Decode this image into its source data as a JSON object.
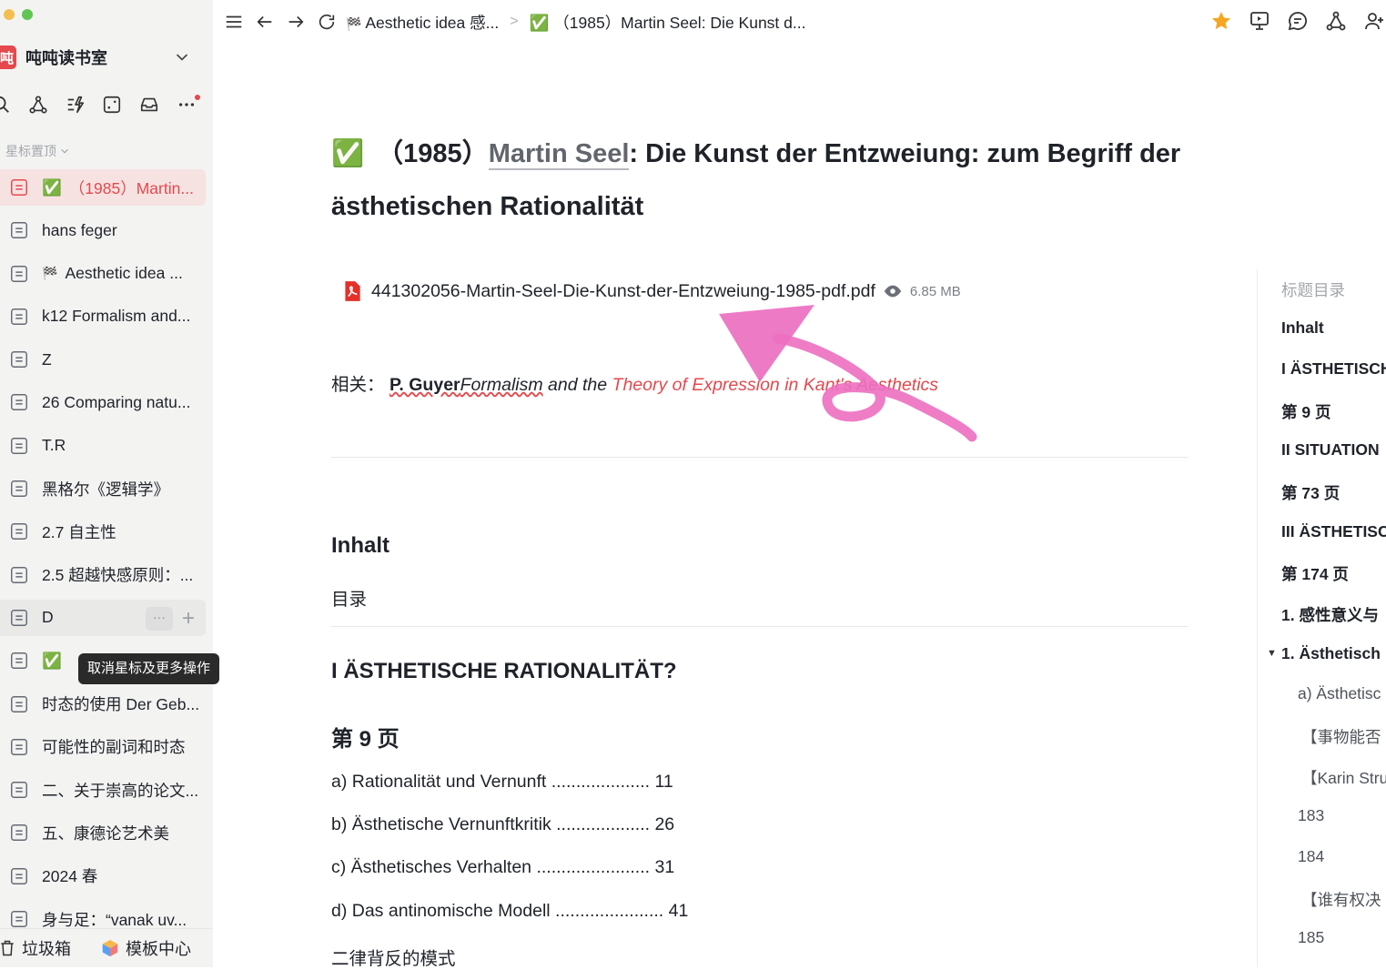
{
  "sidebar": {
    "workspace": {
      "logo": "吨",
      "name": "吨吨读书室"
    },
    "section_title": "星标置顶",
    "items": [
      {
        "emoji": "✅",
        "label": "（1985）Martin..."
      },
      {
        "emoji": "",
        "label": "hans feger"
      },
      {
        "emoji": "🏁",
        "label": "Aesthetic idea ..."
      },
      {
        "emoji": "",
        "label": "k12 Formalism and..."
      },
      {
        "emoji": "",
        "label": "Z"
      },
      {
        "emoji": "",
        "label": "26 Comparing natu..."
      },
      {
        "emoji": "",
        "label": "T.R"
      },
      {
        "emoji": "",
        "label": "黑格尔《逻辑学》"
      },
      {
        "emoji": "",
        "label": "2.7 自主性"
      },
      {
        "emoji": "",
        "label": "2.5 超越快感原则：..."
      },
      {
        "emoji": "",
        "label": "D"
      },
      {
        "emoji": "✅",
        "label": ""
      },
      {
        "emoji": "",
        "label": "时态的使用 Der Geb..."
      },
      {
        "emoji": "",
        "label": "可能性的副词和时态"
      },
      {
        "emoji": "",
        "label": "二、关于崇高的论文..."
      },
      {
        "emoji": "",
        "label": "五、康德论艺术美"
      },
      {
        "emoji": "",
        "label": "2024 春"
      },
      {
        "emoji": "",
        "label": "身与足：“vanak uv..."
      }
    ],
    "more_button": "···",
    "add_button": "+",
    "tooltip": "取消星标及更多操作",
    "bottom": {
      "trash": "垃圾箱",
      "templates": "模板中心"
    }
  },
  "topbar": {
    "breadcrumb": [
      {
        "emoji": "🏁",
        "label": "Aesthetic idea 感..."
      },
      {
        "emoji": "✅",
        "label": "（1985）Martin Seel: Die Kunst d..."
      }
    ]
  },
  "doc": {
    "title_emoji": "✅",
    "title_prefix": "（1985）",
    "title_link": "Martin Seel",
    "title_rest": ": Die Kunst der Entzweiung: zum Begriff der",
    "title_line2": "ästhetischen Rationalität",
    "attachment": {
      "name": "441302056-Martin-Seel-Die-Kunst-der-Entzweiung-1985-pdf.pdf",
      "size": "6.85 MB"
    },
    "related": {
      "label": "相关：",
      "author": "P. Guyer",
      "link1": "Formalism",
      "mid": " and the ",
      "link2": "Theory of Expression in Kant's Aesthetics"
    },
    "h_inhalt": "Inhalt",
    "mulu": "目录",
    "h_section1": "I ÄSTHETISCHE RATIONALITÄT?",
    "h_page9": "第 9 页",
    "toc": [
      "a) Rationalität und Vernunft .................... 11",
      "b) Ästhetische Vernunftkritik ................... 26",
      "c) Ästhetisches Verhalten ....................... 31",
      "d) Das antinomische Modell ...................... 41"
    ],
    "last_line": "二律背反的模式"
  },
  "outline": {
    "title": "标题目录",
    "items": [
      {
        "label": "Inhalt",
        "style": "bold"
      },
      {
        "label": "I ÄSTHETISCHE",
        "style": "bold"
      },
      {
        "label": "第 9 页",
        "style": "bold"
      },
      {
        "label": "II SITUATION",
        "style": "bold"
      },
      {
        "label": "第 73 页",
        "style": "bold"
      },
      {
        "label": "III ÄSTHETISC",
        "style": "bold"
      },
      {
        "label": "第 174 页",
        "style": "bold"
      },
      {
        "label": "1. 感性意义与",
        "style": "bold"
      },
      {
        "label": "1. Ästhetisch",
        "style": "bold"
      },
      {
        "label": "a) Ästhetisc",
        "style": "dim"
      },
      {
        "label": "【事物能否",
        "style": "dim"
      },
      {
        "label": "【Karin Stru",
        "style": "dim"
      },
      {
        "label": "183",
        "style": "dim"
      },
      {
        "label": "184",
        "style": "dim"
      },
      {
        "label": "【谁有权决",
        "style": "dim"
      },
      {
        "label": "185",
        "style": "dim"
      }
    ]
  },
  "colors": {
    "accent": "#e5484d",
    "star": "#f5a623",
    "annotation": "#ec6fc0"
  }
}
